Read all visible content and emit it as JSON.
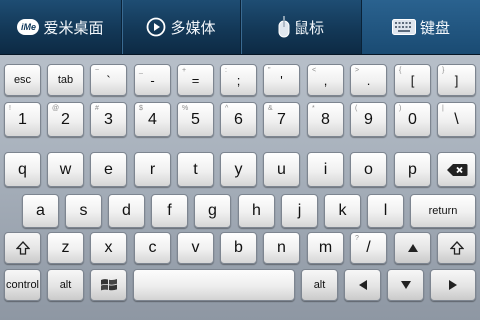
{
  "tabs": [
    {
      "label": "爱米桌面",
      "icon": "ime-logo-icon",
      "logo_text": "iMe"
    },
    {
      "label": "多媒体",
      "icon": "play-circle-icon"
    },
    {
      "label": "鼠标",
      "icon": "mouse-icon"
    },
    {
      "label": "键盘",
      "icon": "keyboard-icon",
      "active": true
    }
  ],
  "keyboard": {
    "row1": [
      {
        "label": "esc",
        "sub": ""
      },
      {
        "label": "tab",
        "sub": ""
      },
      {
        "label": "`",
        "sub": "~"
      },
      {
        "label": "-",
        "sub": "_"
      },
      {
        "label": "=",
        "sub": "+"
      },
      {
        "label": ";",
        "sub": ":"
      },
      {
        "label": "'",
        "sub": "\""
      },
      {
        "label": ",",
        "sub": "<"
      },
      {
        "label": ".",
        "sub": ">"
      },
      {
        "label": "[",
        "sub": "{"
      },
      {
        "label": "]",
        "sub": "}"
      }
    ],
    "row2": [
      {
        "label": "1",
        "sub": "!"
      },
      {
        "label": "2",
        "sub": "@"
      },
      {
        "label": "3",
        "sub": "#"
      },
      {
        "label": "4",
        "sub": "$"
      },
      {
        "label": "5",
        "sub": "%"
      },
      {
        "label": "6",
        "sub": "^"
      },
      {
        "label": "7",
        "sub": "&"
      },
      {
        "label": "8",
        "sub": "*"
      },
      {
        "label": "9",
        "sub": "("
      },
      {
        "label": "0",
        "sub": ")"
      },
      {
        "label": "\\",
        "sub": "|"
      }
    ],
    "row3": [
      "q",
      "w",
      "e",
      "r",
      "t",
      "y",
      "u",
      "i",
      "o",
      "p"
    ],
    "row4": [
      "a",
      "s",
      "d",
      "f",
      "g",
      "h",
      "j",
      "k",
      "l"
    ],
    "return_label": "return",
    "row5": [
      "z",
      "x",
      "c",
      "v",
      "b",
      "n",
      "m"
    ],
    "slash": {
      "label": "/",
      "sub": "?"
    },
    "control_label": "control",
    "alt_label": "alt"
  },
  "colors": {
    "topbar": "#133857",
    "active_tab": "#1a4b73",
    "keyboard_bg": "#aab3be",
    "key_face": "#f0f0f0"
  }
}
